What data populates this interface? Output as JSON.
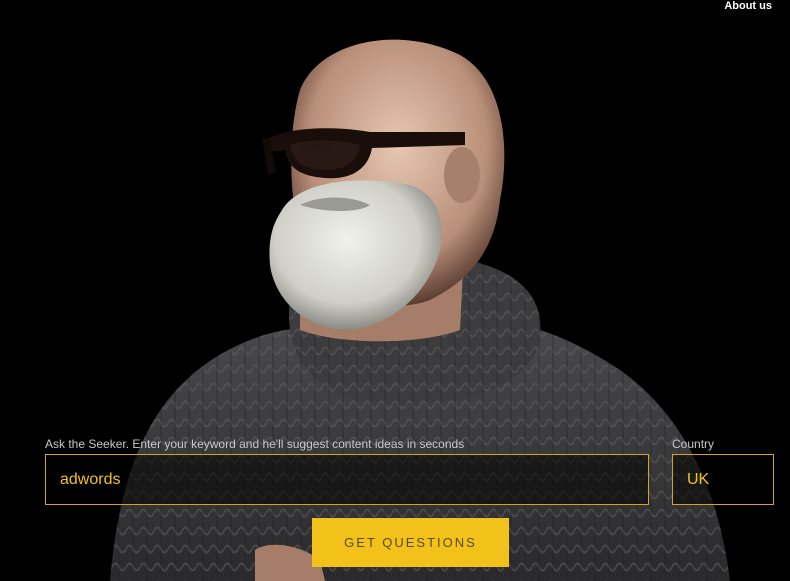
{
  "header": {
    "about_label": "About us"
  },
  "search": {
    "keyword_label": "Ask the Seeker. Enter your keyword and he'll suggest content ideas in seconds",
    "keyword_value": "adwords",
    "country_label": "Country",
    "country_value": "UK",
    "submit_label": "GET QUESTIONS"
  },
  "colors": {
    "accent": "#f2c21a",
    "background": "#000000",
    "label": "#c8c8c8"
  }
}
